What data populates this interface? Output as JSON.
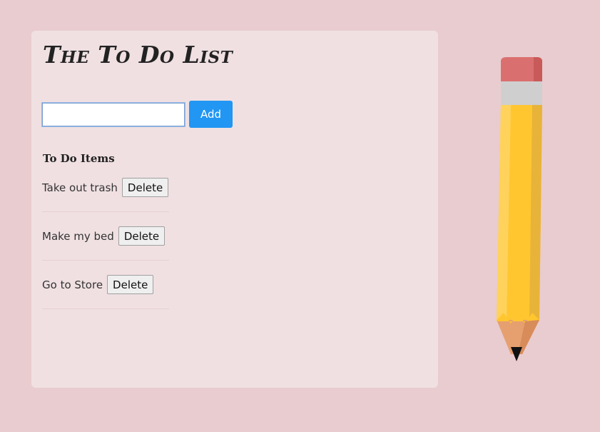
{
  "app": {
    "title": "The To Do List"
  },
  "form": {
    "input_value": "",
    "input_placeholder": "",
    "add_label": "Add"
  },
  "list": {
    "heading": "To Do Items",
    "items": [
      {
        "text": "Take out trash",
        "delete_label": "Delete"
      },
      {
        "text": "Make my bed",
        "delete_label": "Delete"
      },
      {
        "text": "Go to Store",
        "delete_label": "Delete"
      }
    ]
  },
  "decor": {
    "illustration": "pencil-icon"
  },
  "colors": {
    "background": "#e9cccf",
    "card": "#f0e0e2",
    "accent": "#2196f3",
    "pencil_body": "#ffc630",
    "pencil_eraser": "#d9706f"
  }
}
